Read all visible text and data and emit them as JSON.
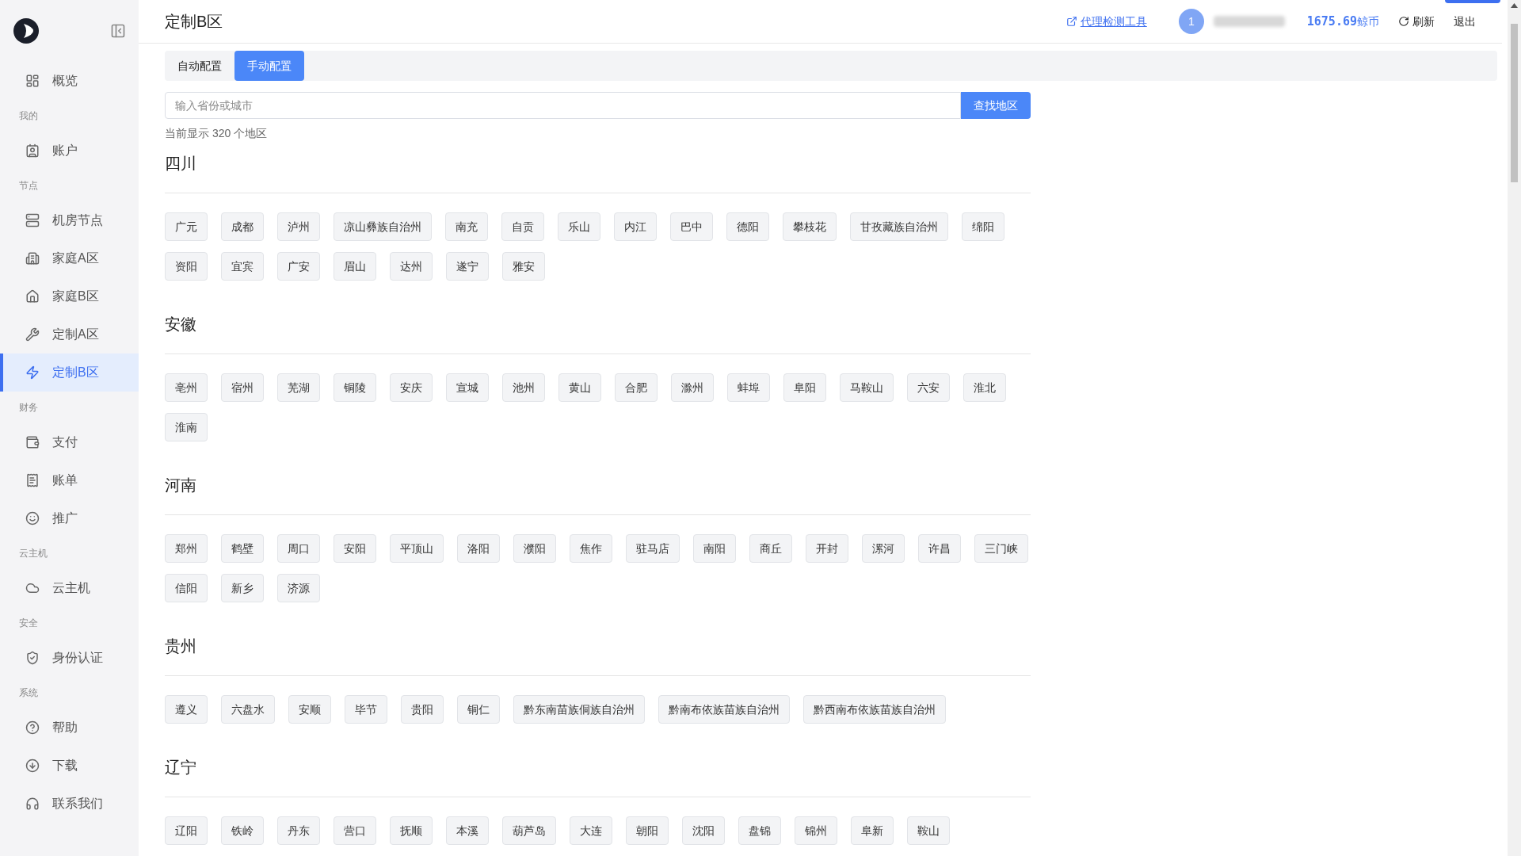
{
  "sidebar": {
    "items": [
      {
        "kind": "item",
        "label": "概览",
        "selected": false
      },
      {
        "kind": "section",
        "label": "我的"
      },
      {
        "kind": "item",
        "label": "账户",
        "selected": false
      },
      {
        "kind": "section",
        "label": "节点"
      },
      {
        "kind": "item",
        "label": "机房节点",
        "selected": false
      },
      {
        "kind": "item",
        "label": "家庭A区",
        "selected": false
      },
      {
        "kind": "item",
        "label": "家庭B区",
        "selected": false
      },
      {
        "kind": "item",
        "label": "定制A区",
        "selected": false
      },
      {
        "kind": "item",
        "label": "定制B区",
        "selected": true
      },
      {
        "kind": "section",
        "label": "财务"
      },
      {
        "kind": "item",
        "label": "支付",
        "selected": false
      },
      {
        "kind": "item",
        "label": "账单",
        "selected": false
      },
      {
        "kind": "item",
        "label": "推广",
        "selected": false
      },
      {
        "kind": "section",
        "label": "云主机"
      },
      {
        "kind": "item",
        "label": "云主机",
        "selected": false
      },
      {
        "kind": "section",
        "label": "安全"
      },
      {
        "kind": "item",
        "label": "身份认证",
        "selected": false
      },
      {
        "kind": "section",
        "label": "系统"
      },
      {
        "kind": "item",
        "label": "帮助",
        "selected": false
      },
      {
        "kind": "item",
        "label": "下载",
        "selected": false
      },
      {
        "kind": "item",
        "label": "联系我们",
        "selected": false
      }
    ]
  },
  "header": {
    "title": "定制B区",
    "proxy_tool_link": "代理检测工具",
    "avatar": "1",
    "balance": "1675.69",
    "currency": "鲸币",
    "refresh": "刷新",
    "logout": "退出"
  },
  "tabs": [
    {
      "label": "自动配置",
      "selected": false
    },
    {
      "label": "手动配置",
      "selected": true
    }
  ],
  "search": {
    "placeholder": "输入省份或城市",
    "button": "查找地区"
  },
  "count_text": "当前显示 320 个地区",
  "provinces": [
    {
      "name": "四川",
      "cities": [
        "广元",
        "成都",
        "泸州",
        "凉山彝族自治州",
        "南充",
        "自贡",
        "乐山",
        "内江",
        "巴中",
        "德阳",
        "攀枝花",
        "甘孜藏族自治州",
        "绵阳",
        "资阳",
        "宜宾",
        "广安",
        "眉山",
        "达州",
        "遂宁",
        "雅安"
      ]
    },
    {
      "name": "安徽",
      "cities": [
        "亳州",
        "宿州",
        "芜湖",
        "铜陵",
        "安庆",
        "宣城",
        "池州",
        "黄山",
        "合肥",
        "滁州",
        "蚌埠",
        "阜阳",
        "马鞍山",
        "六安",
        "淮北",
        "淮南"
      ]
    },
    {
      "name": "河南",
      "cities": [
        "郑州",
        "鹤壁",
        "周口",
        "安阳",
        "平顶山",
        "洛阳",
        "濮阳",
        "焦作",
        "驻马店",
        "南阳",
        "商丘",
        "开封",
        "漯河",
        "许昌",
        "三门峡",
        "信阳",
        "新乡",
        "济源"
      ]
    },
    {
      "name": "贵州",
      "cities": [
        "遵义",
        "六盘水",
        "安顺",
        "毕节",
        "贵阳",
        "铜仁",
        "黔东南苗族侗族自治州",
        "黔南布依族苗族自治州",
        "黔西南布依族苗族自治州"
      ]
    },
    {
      "name": "辽宁",
      "cities": [
        "辽阳",
        "铁岭",
        "丹东",
        "营口",
        "抚顺",
        "本溪",
        "葫芦岛",
        "大连",
        "朝阳",
        "沈阳",
        "盘锦",
        "锦州",
        "阜新",
        "鞍山"
      ]
    }
  ]
}
